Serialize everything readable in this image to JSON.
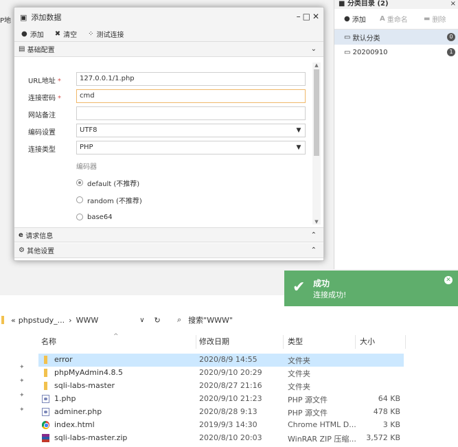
{
  "background": {
    "left_stub": "P地"
  },
  "right_panel": {
    "title": "分类目录 (2)",
    "close": "×",
    "toolbar": {
      "add": "添加",
      "rename": "重命名",
      "delete": "删除"
    },
    "categories": [
      {
        "name": "默认分类",
        "count": "0"
      },
      {
        "name": "20200910",
        "count": "1"
      }
    ]
  },
  "dialog": {
    "title": "添加数据",
    "toolbar": {
      "add": "添加",
      "clear": "清空",
      "test": "测试连接"
    },
    "sections": {
      "basic": "基础配置",
      "request": "请求信息",
      "other": "其他设置"
    },
    "fields": {
      "url_label": "URL地址",
      "url_value": "127.0.0.1/1.php",
      "password_label": "连接密码",
      "password_value": "cmd",
      "note_label": "网站备注",
      "note_value": "",
      "encoding_label": "编码设置",
      "encoding_value": "UTF8",
      "type_label": "连接类型",
      "type_value": "PHP",
      "encoder_label": "编码器"
    },
    "required_mark": "*",
    "encoders": [
      {
        "label": "default (不推荐)",
        "checked": true
      },
      {
        "label": "random (不推荐)",
        "checked": false
      },
      {
        "label": "base64",
        "checked": false
      }
    ]
  },
  "toast": {
    "title": "成功",
    "message": "连接成功!"
  },
  "explorer": {
    "breadcrumb": {
      "prefix": "«",
      "path1": "phpstudy_...",
      "sep": "›",
      "path2": "WWW",
      "dropdown": "∨",
      "refresh": "↻"
    },
    "search_placeholder": "搜索\"WWW\"",
    "columns": {
      "name": "名称",
      "date": "修改日期",
      "type": "类型",
      "size": "大小"
    },
    "files": [
      {
        "name": "error",
        "date": "2020/8/9 14:55",
        "type": "文件夹",
        "size": "",
        "icon": "folder-icon"
      },
      {
        "name": "phpMyAdmin4.8.5",
        "date": "2020/9/10 20:29",
        "type": "文件夹",
        "size": "",
        "icon": "folder-icon"
      },
      {
        "name": "sqli-labs-master",
        "date": "2020/8/27 21:16",
        "type": "文件夹",
        "size": "",
        "icon": "folder-icon"
      },
      {
        "name": "1.php",
        "date": "2020/9/10 21:23",
        "type": "PHP 源文件",
        "size": "64 KB",
        "icon": "php-file-icon"
      },
      {
        "name": "adminer.php",
        "date": "2020/8/28 9:13",
        "type": "PHP 源文件",
        "size": "478 KB",
        "icon": "php-file-icon"
      },
      {
        "name": "index.html",
        "date": "2019/9/3 14:30",
        "type": "Chrome HTML D...",
        "size": "3 KB",
        "icon": "chrome-icon"
      },
      {
        "name": "sqli-labs-master.zip",
        "date": "2020/8/10 20:03",
        "type": "WinRAR ZIP 压缩...",
        "size": "3,572 KB",
        "icon": "winrar-icon"
      }
    ]
  }
}
